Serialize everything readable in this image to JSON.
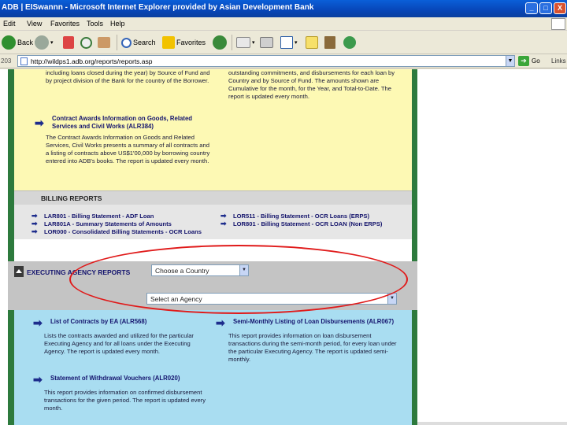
{
  "window": {
    "title": "ADB | EISwannn - Microsoft Internet Explorer provided by Asian Development Bank",
    "minimize": "_",
    "maximize": "□",
    "close": "X"
  },
  "menu": {
    "items": [
      "Edit",
      "View",
      "Favorites",
      "Tools",
      "Help"
    ]
  },
  "toolbar": {
    "back": "Back",
    "search": "Search",
    "favorites": "Favorites"
  },
  "address": {
    "label": "203",
    "url": "http://wildps1.adb.org/reports/reports.asp",
    "go": "Go",
    "links": "Links"
  },
  "page": {
    "top_left_text": "including loans closed during the year) by Source of Fund and by project division of the Bank for the country of the Borrower.",
    "top_right_text": "outstanding commitments, and disbursements for each loan by Country and by Source of Fund. The amounts shown are Cumulative for the month, for the Year, and Total-to-Date. The report is updated every month.",
    "contract_awards": {
      "title": "Contract Awards Information on Goods, Related Services and Civil Works (ALR384)",
      "desc": "The Contract Awards Information on Goods and Related Services, Civil Works presents a summary of all contracts and a listing of contracts above US$1'00,000 by borrowing country entered into ADB's books. The report is updated every month."
    },
    "billing": {
      "heading": "BILLING REPORTS",
      "left": [
        "LAR801 - Billing Statement - ADF Loan",
        "LAR801A - Summary Statements of Amounts",
        "LOR000 - Consolidated Billing Statements - OCR Loans"
      ],
      "right": [
        "LOR511 - Billing Statement - OCR Loans (ERPS)",
        "LOR801 - Billing Statement - OCR LOAN (Non ERPS)"
      ]
    },
    "executing": {
      "heading": "EXECUTING AGENCY REPORTS",
      "country_select": "Choose a Country",
      "agency_select": "Select an Agency"
    },
    "ea_reports": {
      "contracts": {
        "title": "List of Contracts by EA (ALR568)",
        "desc": "Lists the contracts awarded and utilized for the particular Executing Agency and for all loans under the Executing Agency. The report is updated every month."
      },
      "semi_monthly": {
        "title": "Semi-Monthly Listing of Loan Disbursements (ALR067)",
        "desc": "This report provides information on loan disbursement transactions during the semi-month period, for every loan under the particular Executing Agency. The report is updated semi-monthly."
      },
      "withdrawal": {
        "title": "Statement of Withdrawal Vouchers (ALR020)",
        "desc": "This report provides information on confirmed disbursement transactions for the given period. The report is updated every month."
      }
    }
  },
  "colors": {
    "frame_green": "#2d7a3d",
    "yellow_panel": "#fdf9b4",
    "blue_panel": "#a9ddf1",
    "annotation_red": "#e01a1a"
  }
}
